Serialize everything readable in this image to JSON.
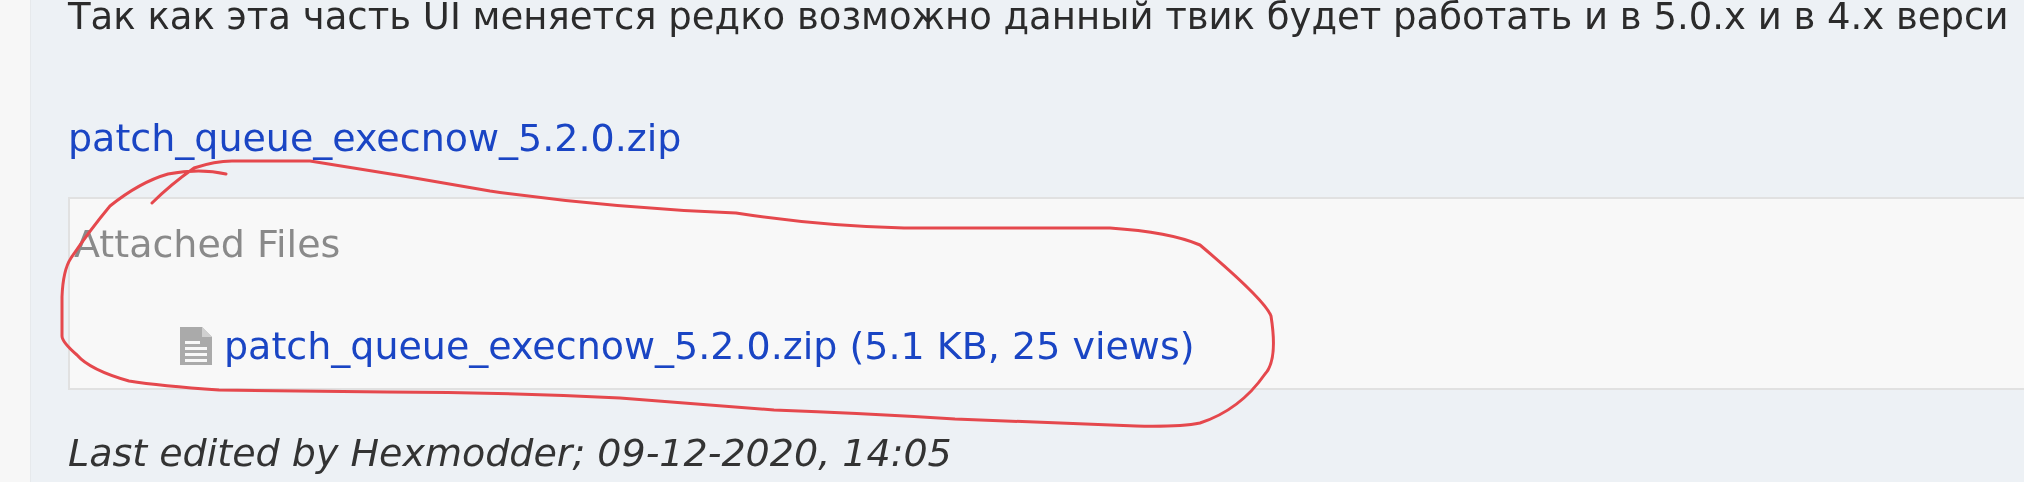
{
  "post": {
    "text": "Так как эта часть UI меняется редко возможно данный твик будет работать и в 5.0.x и в 4.x верси",
    "link": "patch_queue_execnow_5.2.0.zip",
    "attachments": {
      "title": "Attached Files",
      "files": [
        {
          "name": "patch_queue_execnow_5.2.0.zip (5.1 KB, 25 views)"
        }
      ]
    },
    "edited": "Last edited by Hexmodder; 09-12-2020, 14:05"
  }
}
